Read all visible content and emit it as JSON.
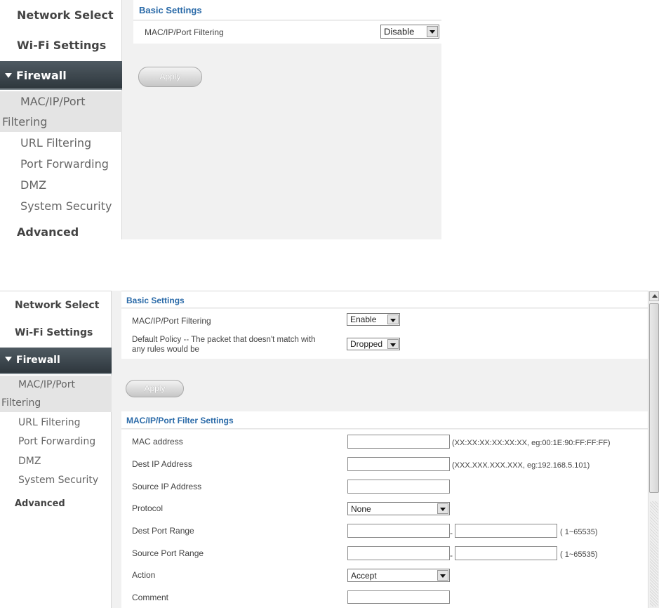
{
  "panel1": {
    "sidebar": {
      "network_select": "Network Select",
      "wifi_settings": "Wi-Fi Settings",
      "firewall": "Firewall",
      "mac_ip_port_line1": "MAC/IP/Port",
      "mac_ip_port_line2": "Filtering",
      "url_filtering": "URL Filtering",
      "port_forwarding": "Port Forwarding",
      "dmz": "DMZ",
      "system_security": "System Security",
      "advanced": "Advanced"
    },
    "basic_settings": {
      "title": "Basic Settings",
      "filter_label": "MAC/IP/Port Filtering",
      "filter_value": "Disable"
    },
    "apply_label": "Apply"
  },
  "panel2": {
    "sidebar": {
      "network_select": "Network Select",
      "wifi_settings": "Wi-Fi Settings",
      "firewall": "Firewall",
      "mac_ip_port_line1": "MAC/IP/Port",
      "mac_ip_port_line2": "Filtering",
      "url_filtering": "URL Filtering",
      "port_forwarding": "Port Forwarding",
      "dmz": "DMZ",
      "system_security": "System Security",
      "advanced": "Advanced"
    },
    "basic_settings": {
      "title": "Basic Settings",
      "filter_label": "MAC/IP/Port Filtering",
      "filter_value": "Enable",
      "policy_label_line1": "Default Policy -- The packet that doesn't match with",
      "policy_label_line2": "any rules would be",
      "policy_value": "Dropped"
    },
    "apply_label": "Apply",
    "filter_settings": {
      "title": "MAC/IP/Port Filter Settings",
      "mac_label": "MAC address",
      "mac_hint": "(XX:XX:XX:XX:XX:XX, eg:00:1E:90:FF:FF:FF)",
      "dest_ip_label": "Dest IP Address",
      "dest_ip_hint": "(XXX.XXX.XXX.XXX, eg:192.168.5.101)",
      "source_ip_label": "Source IP Address",
      "protocol_label": "Protocol",
      "protocol_value": "None",
      "dest_port_label": "Dest Port Range",
      "dest_port_hint": "( 1~65535)",
      "source_port_label": "Source Port Range",
      "source_port_hint": "( 1~65535)",
      "range_separator": "-",
      "action_label": "Action",
      "action_value": "Accept",
      "comment_label": "Comment"
    }
  }
}
